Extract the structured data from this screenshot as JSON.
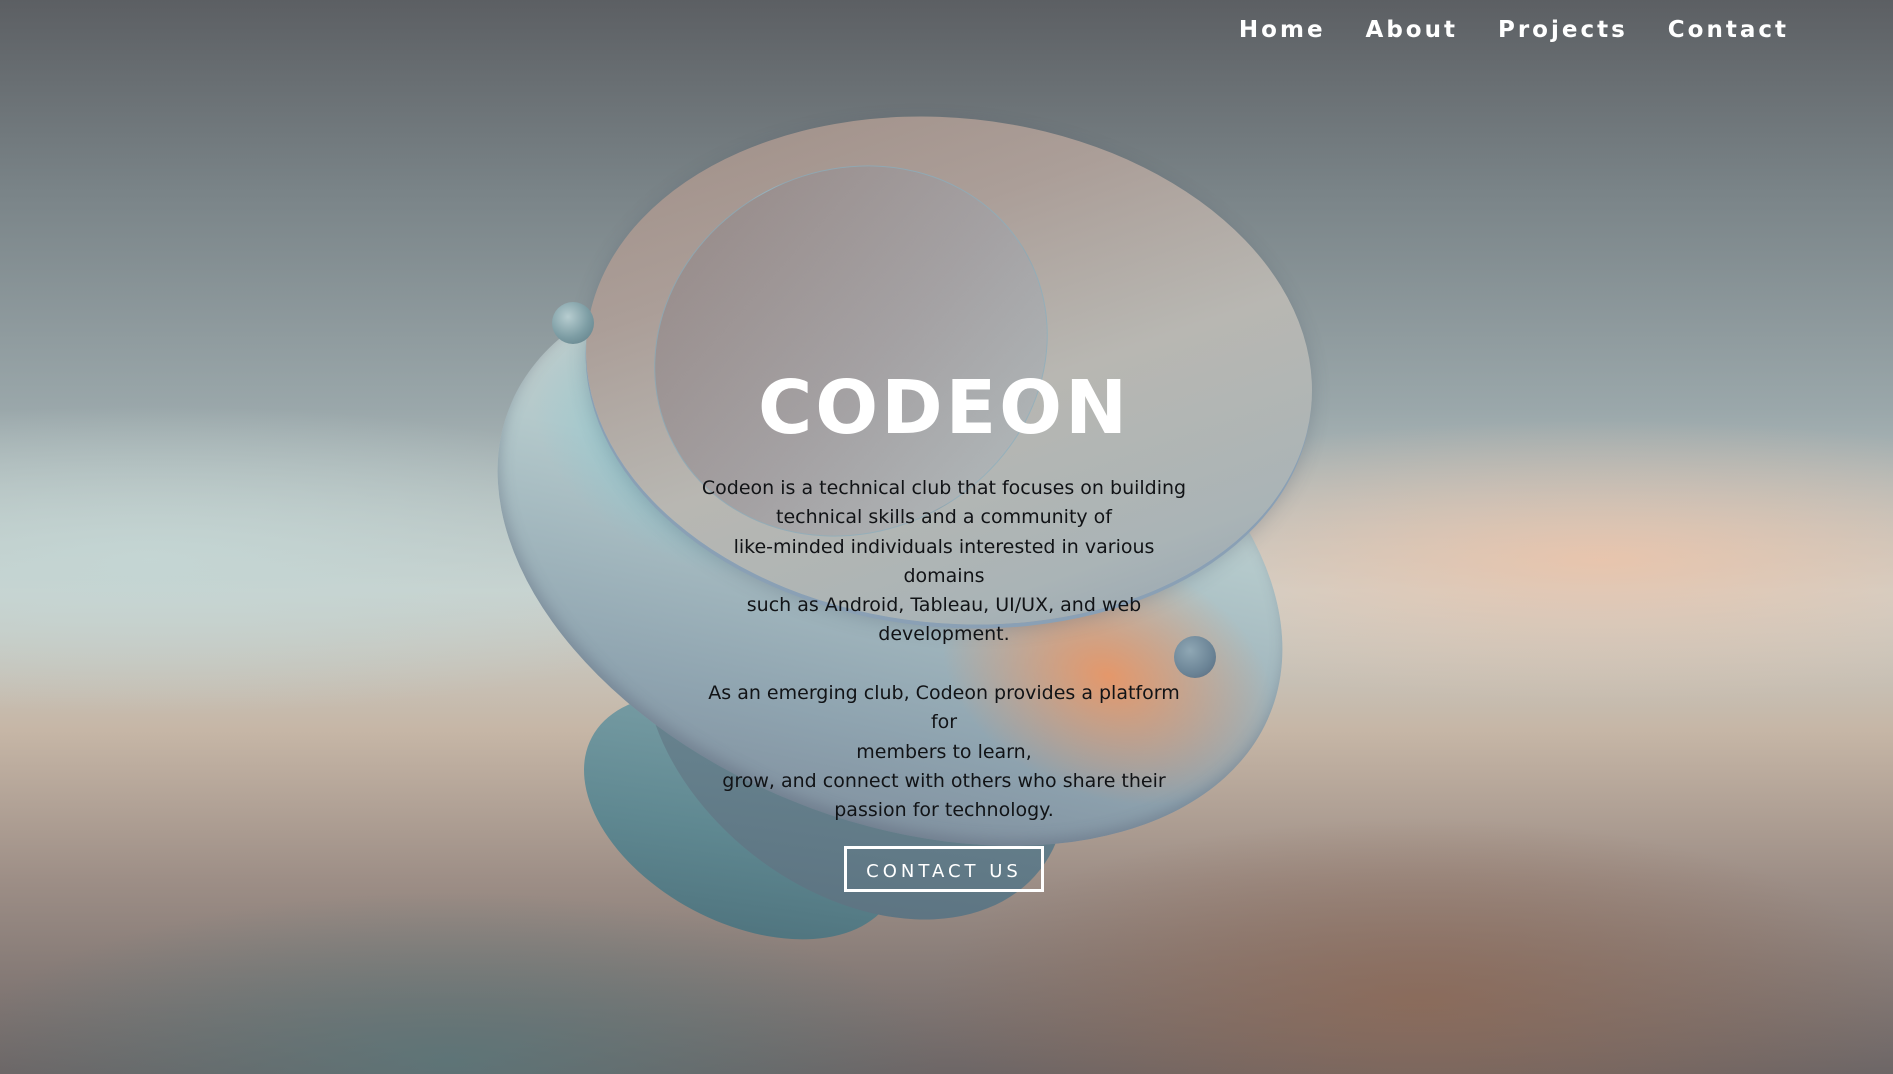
{
  "nav": {
    "items": [
      {
        "label": "Home"
      },
      {
        "label": "About"
      },
      {
        "label": "Projects"
      },
      {
        "label": "Contact"
      }
    ]
  },
  "hero": {
    "title": "CODEON",
    "paragraph1": [
      "Codeon is a technical club that focuses on building",
      "technical skills and a community of",
      "like-minded individuals interested in various domains",
      "such as Android, Tableau, UI/UX, and web",
      "development."
    ],
    "paragraph2": [
      "As an emerging club, Codeon provides a platform for",
      "members to learn,",
      "grow, and connect with others who share their",
      "passion for technology."
    ],
    "button_label": "CONTACT US"
  },
  "colors": {
    "text_light": "#ffffff",
    "text_dark": "#111316",
    "accent_orange": "#e89666",
    "accent_teal": "#7ac8d2"
  }
}
